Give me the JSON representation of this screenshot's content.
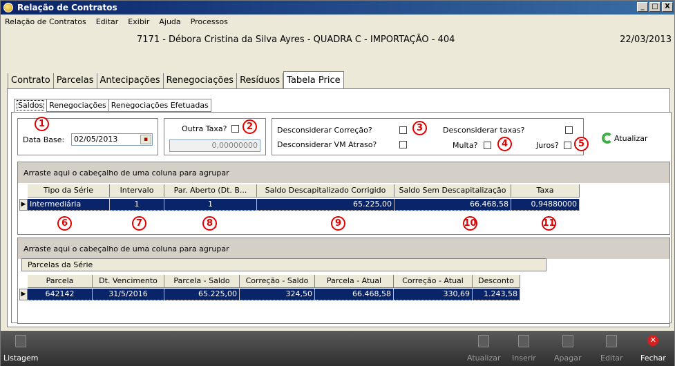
{
  "window": {
    "title": "Relação de Contratos",
    "buttons": [
      "_",
      "□",
      "X"
    ]
  },
  "menu": [
    "Relação de Contratos",
    "Editar",
    "Exibir",
    "Ajuda",
    "Processos"
  ],
  "info": {
    "contract": "7171 - Débora Cristina da Silva Ayres - QUADRA C - IMPORTAÇÃO - 404",
    "date": "22/03/2013"
  },
  "main_tabs": [
    "Contrato",
    "Parcelas",
    "Antecipações",
    "Renegociações",
    "Resíduos",
    "Tabela Price"
  ],
  "sub_tabs": [
    "Saldos",
    "Renegociações",
    "Renegociações Efetuadas"
  ],
  "filters": {
    "data_base_label": "Data Base:",
    "data_base_value": "02/05/2013",
    "outra_taxa_label": "Outra Taxa?",
    "outra_taxa_value": "0,00000000",
    "desc_correcao_label": "Desconsiderar Correção?",
    "desc_vm_label": "Desconsiderar VM Atraso?",
    "desc_taxas_label": "Desconsiderar taxas?",
    "multa_label": "Multa?",
    "juros_label": "Juros?",
    "atualizar_label": "Atualizar"
  },
  "callouts": [
    "1",
    "2",
    "3",
    "4",
    "5",
    "6",
    "7",
    "8",
    "9",
    "10",
    "11"
  ],
  "grid1": {
    "group_hint": "Arraste aqui o cabeçalho de uma coluna para agrupar",
    "headers": [
      "Tipo da Série",
      "Intervalo",
      "Par. Aberto (Dt. B...",
      "Saldo Descapitalizado Corrigido",
      "Saldo Sem Descapitalização",
      "Taxa"
    ],
    "row": [
      "Intermediária",
      "1",
      "1",
      "65.225,00",
      "66.468,58",
      "0,94880000"
    ]
  },
  "grid2": {
    "group_hint": "Arraste aqui o cabeçalho de uma coluna para agrupar",
    "band": "Parcelas da Série",
    "headers": [
      "Parcela",
      "Dt. Vencimento",
      "Parcela - Saldo",
      "Correção - Saldo",
      "Parcela - Atual",
      "Correção - Atual",
      "Desconto"
    ],
    "row": [
      "642142",
      "31/5/2016",
      "65.225,00",
      "324,50",
      "66.468,58",
      "330,69",
      "1.243,58"
    ]
  },
  "toolbar": {
    "listagem": "Listagem",
    "atualizar": "Atualizar",
    "inserir": "Inserir",
    "apagar": "Apagar",
    "editar": "Editar",
    "fechar": "Fechar"
  }
}
